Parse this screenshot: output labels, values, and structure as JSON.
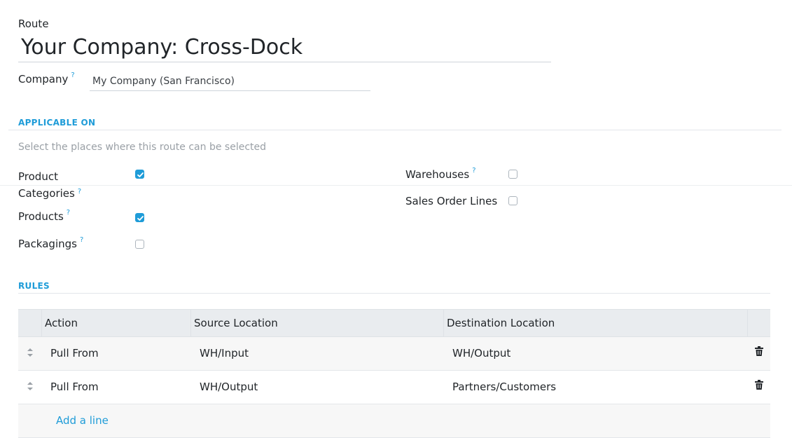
{
  "form": {
    "route_label": "Route",
    "route_name": "Your Company: Cross-Dock",
    "company_label": "Company",
    "company_value": "My Company (San Francisco)",
    "help_mark": "?"
  },
  "applicable_on": {
    "section_title": "APPLICABLE ON",
    "hint": "Select the places where this route can be selected",
    "left": [
      {
        "label_line1": "Product",
        "label_line2": "Categories",
        "checked": true
      },
      {
        "label": "Products",
        "checked": true
      },
      {
        "label": "Packagings",
        "checked": false
      }
    ],
    "right": [
      {
        "label": "Warehouses",
        "checked": false
      },
      {
        "label": "Sales Order Lines",
        "checked": false
      }
    ]
  },
  "rules": {
    "section_title": "RULES",
    "columns": [
      "Action",
      "Source Location",
      "Destination Location"
    ],
    "rows": [
      {
        "action": "Pull From",
        "source": "WH/Input",
        "destination": "WH/Output"
      },
      {
        "action": "Pull From",
        "source": "WH/Output",
        "destination": "Partners/Customers"
      }
    ],
    "add_line": "Add a line"
  },
  "colors": {
    "accent": "#1f9cd8",
    "header_bg": "#e9ecef",
    "row_alt": "#f7f7f7"
  },
  "icons": [
    "help-icon",
    "checkbox-checked-icon",
    "checkbox-unchecked-icon",
    "drag-handle-icon",
    "trash-icon"
  ]
}
